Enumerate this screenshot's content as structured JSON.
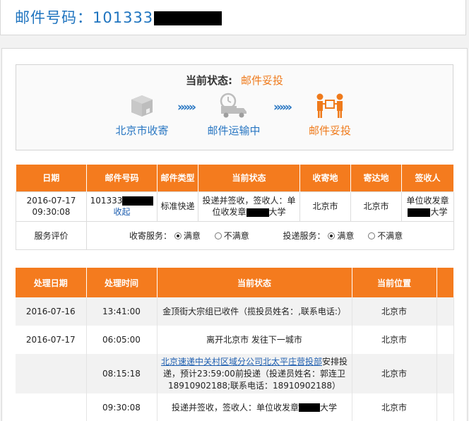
{
  "header": {
    "title": "邮件号码：101333"
  },
  "status": {
    "label": "当前状态:",
    "value": "邮件妥投",
    "steps": [
      {
        "label": "北京市收寄",
        "icon": "package-box-icon"
      },
      {
        "label": "邮件运输中",
        "icon": "delivery-truck-icon"
      },
      {
        "label": "邮件妥投",
        "icon": "handover-people-icon"
      }
    ],
    "arrow": "»»»"
  },
  "mail_table": {
    "headers": [
      "日期",
      "邮件号码",
      "邮件类型",
      "当前状态",
      "收寄地",
      "寄达地",
      "签收人"
    ],
    "row": {
      "date": "2016-07-17 09:30:08",
      "mail_no": "101333",
      "collapse": "收起",
      "type": "标准快递",
      "status_a": "投递并签收，签收人：单位收发章",
      "status_b": "大学",
      "origin": "北京市",
      "dest": "北京市",
      "signer_a": "单位收发章",
      "signer_b": "大学"
    },
    "rating": {
      "label": "服务评价",
      "collect_label": "收寄服务：",
      "deliver_label": "投递服务：",
      "satisfied": "满意",
      "unsatisfied": "不满意"
    }
  },
  "trace_table": {
    "headers": [
      "处理日期",
      "处理时间",
      "当前状态",
      "当前位置"
    ],
    "rows": [
      {
        "date": "2016-07-16",
        "time": "13:41:00",
        "status": "金顶街大宗组已收件（揽投员姓名：,联系电话:）",
        "loc": "北京市"
      },
      {
        "date": "2016-07-17",
        "time": "06:05:00",
        "status": "离开北京市 发往下一城市",
        "loc": "北京市"
      },
      {
        "date": "",
        "time": "08:15:18",
        "status_link": "北京速递中关村区域分公司北太平庄营投部",
        "status": "安排投递，预计23:59:00前投递（投递员姓名：郭连卫18910902188;联系电话：18910902188）",
        "loc": "北京市"
      },
      {
        "date": "",
        "time": "09:30:08",
        "status_a": "投递并签收，签收人：单位收发章",
        "status_b": "大学",
        "loc": "北京市"
      }
    ]
  }
}
